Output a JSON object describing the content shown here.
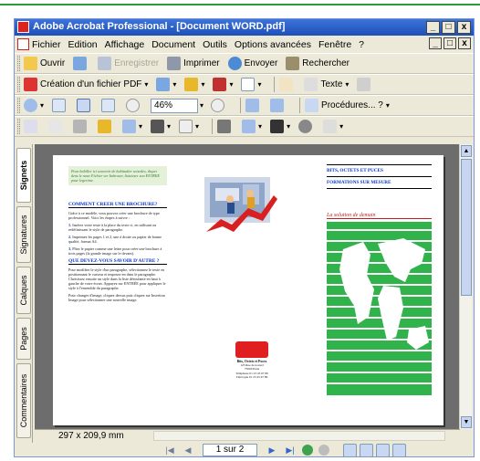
{
  "window": {
    "title": "Adobe Acrobat Professional - [Document WORD.pdf]",
    "minimize": "_",
    "maximize": "□",
    "close": "x"
  },
  "menu": {
    "items": [
      "Fichier",
      "Edition",
      "Affichage",
      "Document",
      "Outils",
      "Options avancées",
      "Fenêtre",
      "?"
    ]
  },
  "toolbar1": {
    "open": "Ouvrir",
    "save": "Enregistrer",
    "print": "Imprimer",
    "send": "Envoyer",
    "search": "Rechercher"
  },
  "toolbar2": {
    "create_pdf": "Création d'un fichier PDF"
  },
  "toolbar3": {
    "zoom": "46%"
  },
  "toolbar4": {
    "text_tool": "Texte",
    "procedures": "Procédures... ?"
  },
  "sidebar": {
    "tabs": [
      "Signets",
      "Signatures",
      "Calques",
      "Pages",
      "Commentaires"
    ]
  },
  "document": {
    "intro_note": "Pour habiller ici souvenir de habitudier seizedes, dispet dens le nouv Fichier ver Imbroser, Saisieser son ENTREE pour legerime.",
    "heading1": "COMMENT CREER UNE BROCHURE?",
    "p1": "Grâce à ce modèle, vous pouvez créer une brochure de type professionnel. Voici les étapes à suivre :",
    "step1": "Insérez votre texte à la place du texte ci, en utilisant ou redéfinissant le style de paragraphe.",
    "step2": "Imprimez les pages 1 et 2, une à droite ou papier de bonne qualité, format A4.",
    "step3": "Pliez le papier comme une lettre pour créer une brochure à trois pages (la grande image sur le devant).",
    "heading2": "QUE DEVEZ-VOUS SAVOIR D'AUTRE ?",
    "p2": "Pour modifier le style d'un paragraphe, sélectionnez le texte en positionnant le curseur et imposez-en dans le paragraphe. Choisissez ensuite un style dans la liste déroulante en haut à gauche de votre écran. Appuyez sur ENTRÉE pour appliquer le style à l'ensemble du paragraphe.",
    "p3": "Pour changer d'image, cliquez dessus puis cliquez sur Insertion Image pour sélectionner une nouvelle image.",
    "right_head1": "BITS, OCTETS ET PUCES",
    "right_head2": "FORMATIONS SUR MESURE",
    "slogan": "La solution de demain",
    "logo_name": "Bits, Octets et Puces",
    "logo_line1": "123 Rue de nouvel",
    "logo_line2": "75000 Paris",
    "logo_line3": "Téléphone 01 23 45 67 89",
    "logo_line4": "Télécopie 01 23 45 67 89"
  },
  "hscroll": {
    "page_size": "297 x 209,9 mm"
  },
  "status": {
    "page_indicator": "1 sur 2"
  },
  "colors": {
    "title_bar": "#1d4fb8",
    "accent_green": "#2e9a3a",
    "doc_heading_blue": "#0033cc",
    "slogan_red": "#c21a1a"
  }
}
